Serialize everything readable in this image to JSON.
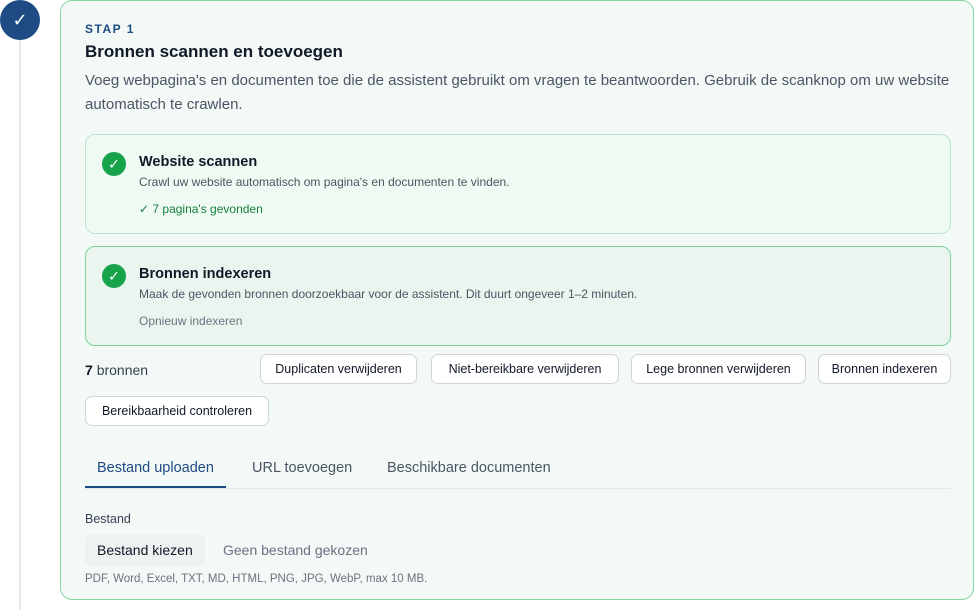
{
  "step": {
    "check_glyph": "✓",
    "label": "STAP 1",
    "title": "Bronnen scannen en toevoegen",
    "description": "Voeg webpagina's en documenten toe die de assistent gebruikt om vragen te beantwoorden. Gebruik de scanknop om uw website automatisch te crawlen."
  },
  "scan": {
    "check_glyph": "✓",
    "title": "Website scannen",
    "description": "Crawl uw website automatisch om pagina's en documenten te vinden.",
    "status": "✓ 7 pagina's gevonden"
  },
  "index": {
    "check_glyph": "✓",
    "title": "Bronnen indexeren",
    "description": "Maak de gevonden bronnen doorzoekbaar voor de assistent. Dit duurt ongeveer 1–2 minuten.",
    "action": "Opnieuw indexeren"
  },
  "sources": {
    "count": "7",
    "count_label": "bronnen"
  },
  "actions": {
    "remove_duplicates": "Duplicaten verwijderen",
    "remove_unreachable": "Niet-bereikbare verwijderen",
    "remove_empty": "Lege bronnen verwijderen",
    "index_sources": "Bronnen indexeren",
    "check_reachability": "Bereikbaarheid controleren"
  },
  "tabs": {
    "upload": "Bestand uploaden",
    "url": "URL toevoegen",
    "available": "Beschikbare documenten"
  },
  "upload": {
    "field_label": "Bestand",
    "choose_button": "Bestand kiezen",
    "no_file": "Geen bestand gekozen",
    "hint": "PDF, Word, Excel, TXT, MD, HTML, PNG, JPG, WebP, max 10 MB."
  },
  "colors": {
    "accent": "#1e4b84",
    "success": "#16a34a",
    "card_border": "#86d6a6"
  }
}
